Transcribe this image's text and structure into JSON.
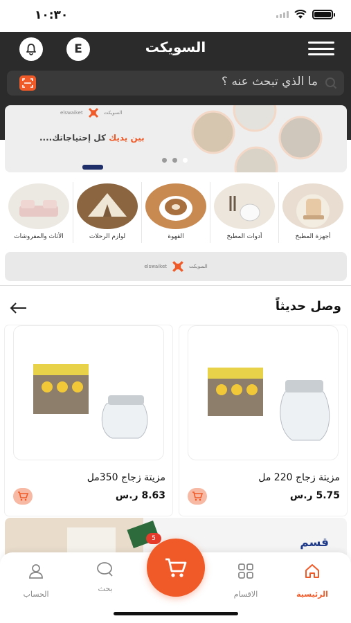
{
  "status_bar": {
    "time": "١٠:٣٠"
  },
  "header": {
    "brand": "السويكت",
    "language_button": "E",
    "search_placeholder": "ما الذي تبحث عنه ؟"
  },
  "banner": {
    "slogan_main": "كل إحتياجاتك....",
    "slogan_accent": "بين يديك",
    "logo_ar": "السويكت",
    "logo_en": "elswaiket"
  },
  "categories": [
    {
      "label": "أجهزة المطبخ",
      "icon": "kitchen-appliance"
    },
    {
      "label": "أدوات المطبخ",
      "icon": "kitchen-tools"
    },
    {
      "label": "القهوة",
      "icon": "coffee-cup"
    },
    {
      "label": "لوازم الرحلات",
      "icon": "tent"
    },
    {
      "label": "الأثاث والمفروشات",
      "icon": "sofa"
    }
  ],
  "banner2": {
    "logo_ar": "السويكت",
    "logo_en": "elswaiket"
  },
  "section": {
    "title": "وصل حديثاً"
  },
  "products": [
    {
      "name": "مزيتة زجاج 220 مل",
      "price": "5.75 ر.س"
    },
    {
      "name": "مزيتة زجاج 350مل",
      "price": "8.63 ر.س"
    }
  ],
  "promo": {
    "title": "قسم",
    "badge": "5"
  },
  "nav": {
    "home": "الرئيسية",
    "categories": "الاقسام",
    "search": "بحث",
    "account": "الحساب"
  },
  "colors": {
    "accent": "#ef5a28",
    "header_bg": "#2b2b2b",
    "promo_title": "#1f3b8a"
  }
}
